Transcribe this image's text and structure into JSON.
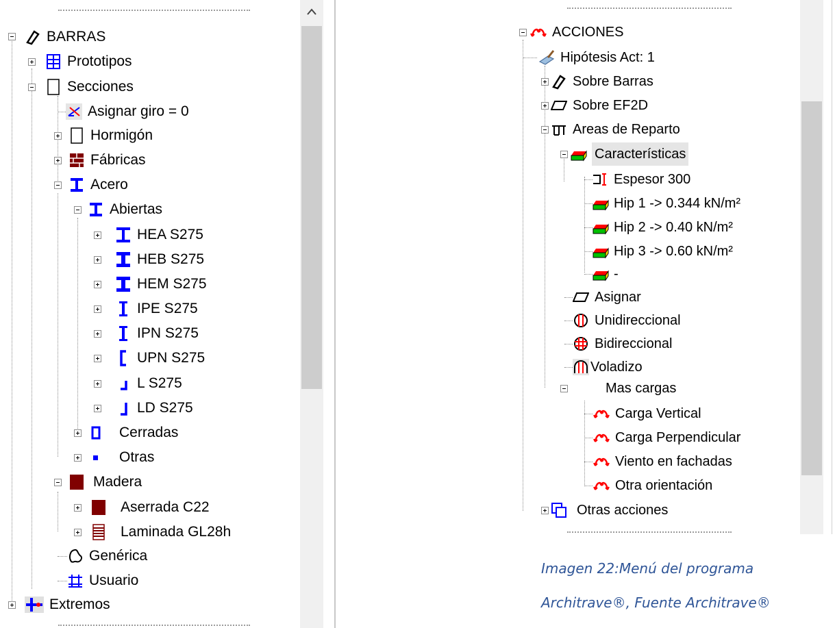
{
  "left_tree": {
    "root": "BARRAS",
    "prototipos": "Prototipos",
    "secciones": "Secciones",
    "asignar_giro": "Asignar giro = 0",
    "hormigon": "Hormigón",
    "fabricas": "Fábricas",
    "acero": "Acero",
    "abiertas": "Abiertas",
    "hea": "HEA S275",
    "heb": "HEB S275",
    "hem": "HEM S275",
    "ipe": "IPE S275",
    "ipn": "IPN S275",
    "upn": "UPN S275",
    "l": "L S275",
    "ld": "LD S275",
    "cerradas": "Cerradas",
    "otras": "Otras",
    "madera": "Madera",
    "aserrada": "Aserrada C22",
    "laminada": "Laminada GL28h",
    "generica": "Genérica",
    "usuario": "Usuario",
    "extremos": "Extremos"
  },
  "right_tree": {
    "root": "ACCIONES",
    "hipotesis": "Hipótesis Act: 1",
    "sobre_barras": "Sobre Barras",
    "sobre_ef2d": "Sobre EF2D",
    "areas": "Areas de Reparto",
    "caracteristicas": "Características",
    "espesor": "Espesor 300",
    "hip1": "Hip 1 -> 0.344 kN/m²",
    "hip2": "Hip 2 -> 0.40 kN/m²",
    "hip3": "Hip 3 -> 0.60 kN/m²",
    "dash": "-",
    "asignar": "Asignar",
    "unidireccional": "Unidireccional",
    "bidireccional": "Bidireccional",
    "voladizo": "Voladizo",
    "mas_cargas": "Mas cargas",
    "carga_vertical": "Carga Vertical",
    "carga_perpendicular": "Carga Perpendicular",
    "viento": "Viento en fachadas",
    "otra_orientacion": "Otra orientación",
    "otras_acciones": "Otras acciones"
  },
  "caption": {
    "line1": "Imagen 22:Menú del programa",
    "line2": "Architrave®, Fuente Architrave®"
  },
  "colors": {
    "steel_blue": "#0000ff",
    "wood": "#800000",
    "action_red": "#ff0000",
    "area_green": "#00c000",
    "caption": "#2f5597"
  }
}
